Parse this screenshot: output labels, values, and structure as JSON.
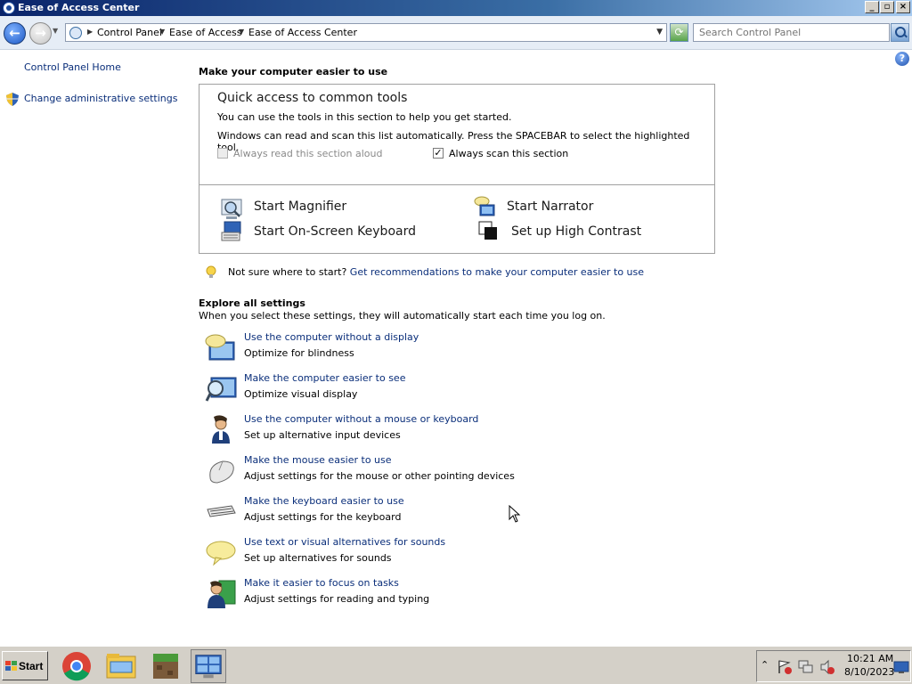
{
  "window": {
    "title": "Ease of Access Center",
    "min_label": "_",
    "max_label": "▫",
    "close_label": "×"
  },
  "nav": {
    "back_label": "←",
    "fwd_label": "→",
    "breadcrumbs": [
      "Control Panel",
      "Ease of Access",
      "Ease of Access Center"
    ],
    "search_placeholder": "Search Control Panel",
    "help_label": "?"
  },
  "left_pane": {
    "home": "Control Panel Home",
    "admin": "Change administrative settings"
  },
  "main": {
    "heading": "Make your computer easier to use",
    "quick": {
      "title": "Quick access to common tools",
      "desc1": "You can use the tools in this section to help you get started.",
      "desc2": "Windows can read and scan this list automatically.  Press the SPACEBAR to select the highlighted tool.",
      "read_aloud_label": "Always read this section aloud",
      "read_aloud_checked": false,
      "scan_label": "Always scan this section",
      "scan_checked": true,
      "tools": {
        "magnifier": "Start Magnifier",
        "narrator": "Start Narrator",
        "keyboard": "Start On-Screen Keyboard",
        "contrast": "Set up High Contrast"
      }
    },
    "tip": {
      "prefix": "Not sure where to start?",
      "link": "Get recommendations to make your computer easier to use"
    },
    "explore": {
      "heading": "Explore all settings",
      "subheading": "When you select these settings, they will automatically start each time you log on.",
      "items": [
        {
          "title": "Use the computer without a display",
          "desc": "Optimize for blindness",
          "icon": "monitor-speech-icon"
        },
        {
          "title": "Make the computer easier to see",
          "desc": "Optimize visual display",
          "icon": "monitor-magnifier-icon"
        },
        {
          "title": "Use the computer without a mouse or keyboard",
          "desc": "Set up alternative input devices",
          "icon": "person-icon"
        },
        {
          "title": "Make the mouse easier to use",
          "desc": "Adjust settings for the mouse or other pointing devices",
          "icon": "mouse-icon"
        },
        {
          "title": "Make the keyboard easier to use",
          "desc": "Adjust settings for the keyboard",
          "icon": "keyboard-icon"
        },
        {
          "title": "Use text or visual alternatives for sounds",
          "desc": "Set up alternatives for sounds",
          "icon": "speech-bubble-icon"
        },
        {
          "title": "Make it easier to focus on tasks",
          "desc": "Adjust settings for reading and typing",
          "icon": "person-board-icon"
        }
      ]
    }
  },
  "taskbar": {
    "start_label": "Start",
    "apps": [
      "chrome-icon",
      "file-explorer-icon",
      "minecraft-icon",
      "control-panel-icon"
    ],
    "time": "10:21 AM",
    "date": "8/10/2023"
  }
}
